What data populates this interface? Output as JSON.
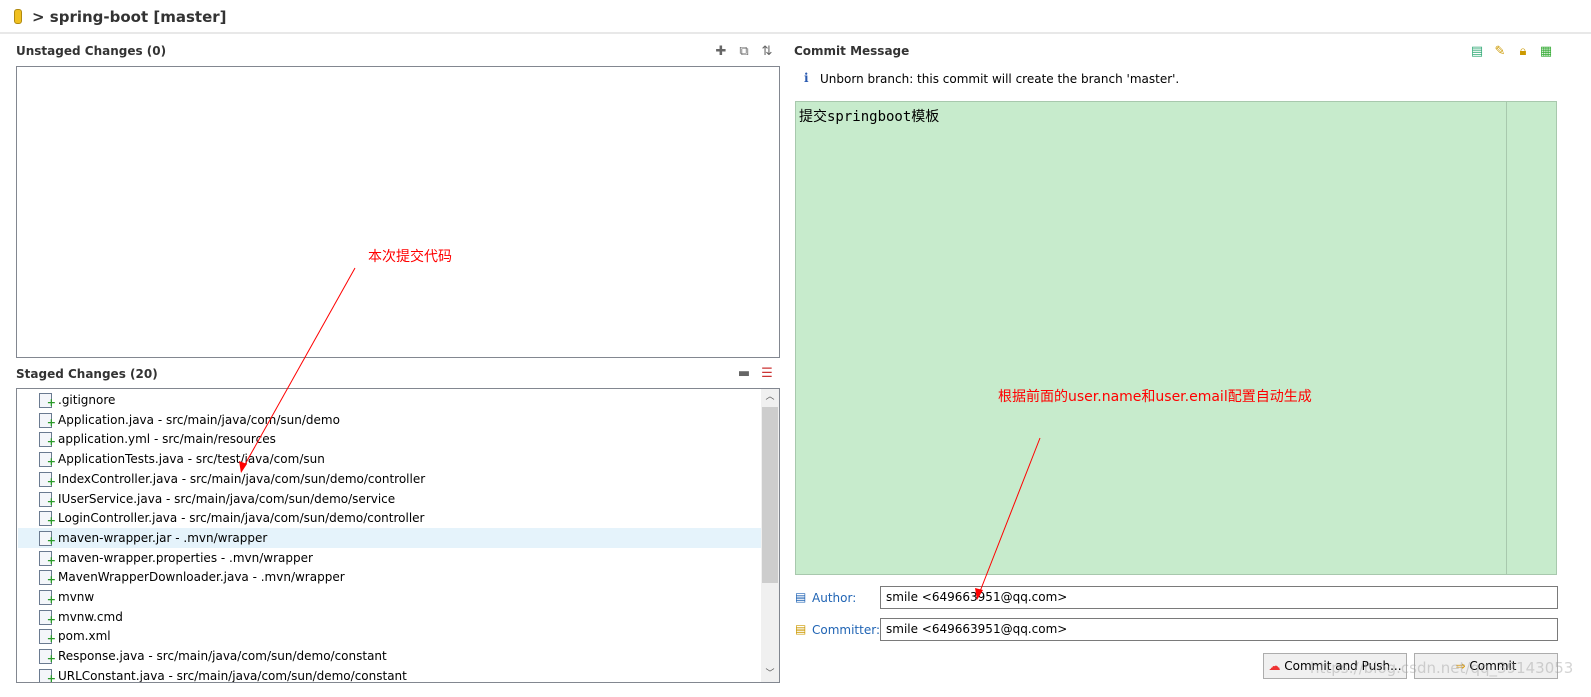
{
  "header": {
    "repo_title": "> spring-boot [master]"
  },
  "unstaged": {
    "title": "Unstaged Changes (0)"
  },
  "staged": {
    "title": "Staged Changes (20)",
    "files": [
      ".gitignore",
      "Application.java - src/main/java/com/sun/demo",
      "application.yml - src/main/resources",
      "ApplicationTests.java - src/test/java/com/sun",
      "IndexController.java - src/main/java/com/sun/demo/controller",
      "IUserService.java - src/main/java/com/sun/demo/service",
      "LoginController.java - src/main/java/com/sun/demo/controller",
      "maven-wrapper.jar - .mvn/wrapper",
      "maven-wrapper.properties - .mvn/wrapper",
      "MavenWrapperDownloader.java - .mvn/wrapper",
      "mvnw",
      "mvnw.cmd",
      "pom.xml",
      "Response.java - src/main/java/com/sun/demo/constant",
      "URLConstant.java - src/main/java/com/sun/demo/constant"
    ],
    "selected_index": 7
  },
  "commit": {
    "title": "Commit Message",
    "info": "Unborn branch: this commit will create the branch 'master'.",
    "message": "提交springboot模板",
    "author_label": "Author:",
    "author_value": "smile <649663951@qq.com>",
    "committer_label": "Committer:",
    "committer_value": "smile <649663951@qq.com>",
    "commit_push_label": "Commit and Push...",
    "commit_label": "Commit"
  },
  "annotations": {
    "staged_note": "本次提交代码",
    "author_note": "根据前面的user.name和user.email配置自动生成",
    "color": "#ff0000"
  },
  "watermark": "https://blog.csdn.net/qq_39143053"
}
